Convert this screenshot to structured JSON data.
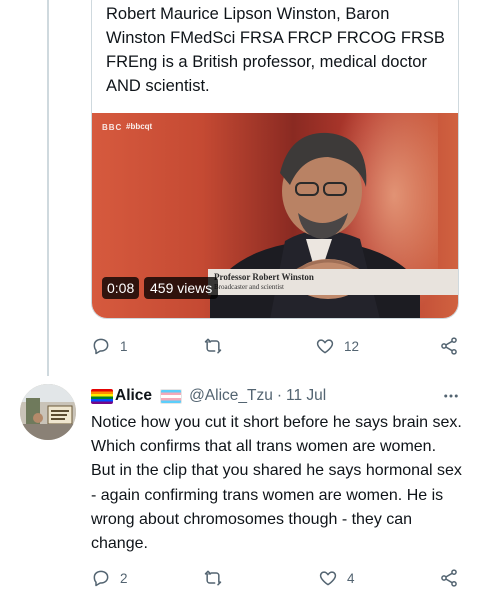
{
  "quoted_tweet": {
    "text": "Robert Maurice Lipson Winston, Baron Winston FMedSci FRSA FRCP FRCOG FRSB FREng is a British professor, medical doctor AND scientist.",
    "video": {
      "channel_logo": "BBC",
      "hashtag": "#bbcqt",
      "caption_name": "Professor Robert Winston",
      "caption_sub": "Broadcaster and scientist",
      "time": "0:08",
      "views": "459 views"
    }
  },
  "quoted_actions": {
    "reply_count": "1",
    "retweet_count": "",
    "like_count": "12",
    "icons": [
      "reply-icon",
      "retweet-icon",
      "like-icon",
      "share-icon"
    ]
  },
  "reply": {
    "display_name": "Alice",
    "handle": "@Alice_Tzu",
    "separator": "·",
    "date": "11 Jul",
    "text": "Notice how you cut it short before he says brain sex. Which confirms that all trans women are women. But in the clip that you shared he says hormonal sex - again confirming trans women are women. He is wrong about chromosomes though - they can change.",
    "flags": [
      "rainbow-flag",
      "trans-flag"
    ]
  },
  "reply_actions": {
    "reply_count": "2",
    "retweet_count": "",
    "like_count": "4",
    "icons": [
      "reply-icon",
      "retweet-icon",
      "like-icon",
      "share-icon"
    ]
  },
  "colors": {
    "text_primary": "#0f1419",
    "text_secondary": "#536471",
    "border": "#cfd9de"
  }
}
